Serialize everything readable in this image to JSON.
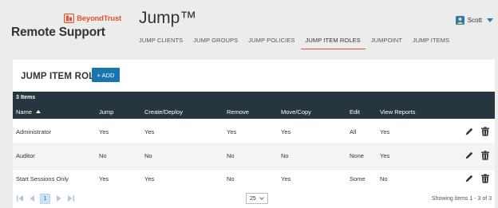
{
  "brand": {
    "name": "BeyondTrust",
    "product": "Remote Support",
    "accent": "#e8512b"
  },
  "app": {
    "title": "Jump™"
  },
  "nav": {
    "tabs": [
      {
        "label": "JUMP CLIENTS"
      },
      {
        "label": "JUMP GROUPS"
      },
      {
        "label": "JUMP POLICIES"
      },
      {
        "label": "JUMP ITEM ROLES",
        "active": true
      },
      {
        "label": "JUMPOINT"
      },
      {
        "label": "JUMP ITEMS"
      }
    ]
  },
  "user": {
    "name": "Scott",
    "icon": "user-badge-icon"
  },
  "card": {
    "title": "JUMP ITEM ROLES",
    "add_label": "+ ADD",
    "add_color": "#1975b0"
  },
  "table": {
    "count": "3 Items",
    "headers": [
      "Name",
      "Jump",
      "Create/Deploy",
      "Remove",
      "Move/Copy",
      "Edit",
      "View Reports"
    ],
    "rows": [
      [
        "Administrator",
        "Yes",
        "Yes",
        "Yes",
        "Yes",
        "All",
        "Yes"
      ],
      [
        "Auditor",
        "No",
        "No",
        "No",
        "No",
        "None",
        "Yes"
      ],
      [
        "Start Sessions Only",
        "Yes",
        "Yes",
        "No",
        "Yes",
        "Some",
        "No"
      ]
    ],
    "row_actions": [
      "pencil-icon",
      "trash-icon"
    ],
    "header_bg": "#27353e"
  },
  "pager": {
    "current_page": "1",
    "page_size": "25",
    "summary": "Showing items 1 - 3 of 3"
  }
}
